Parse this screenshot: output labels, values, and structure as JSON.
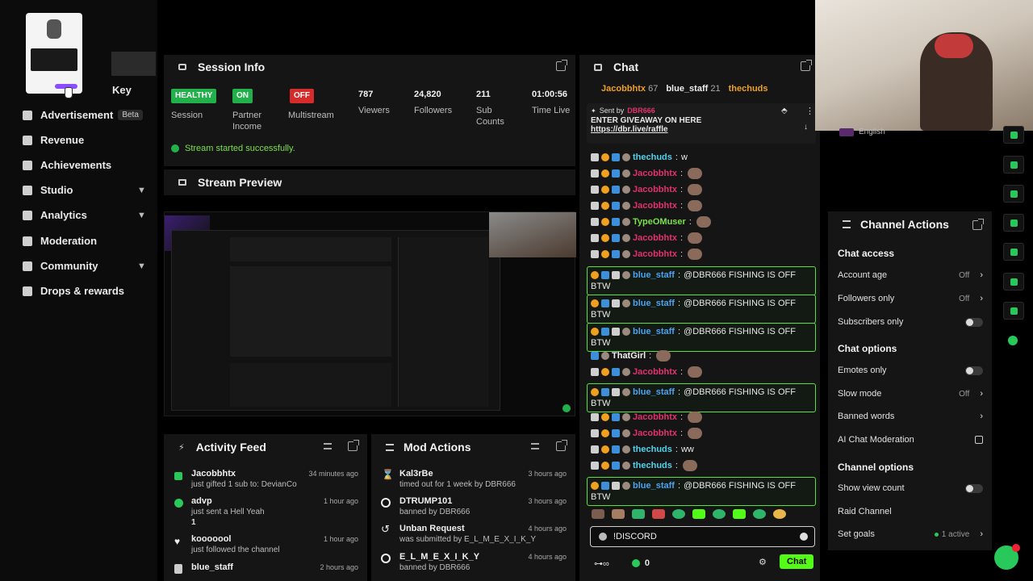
{
  "sidebar": {
    "partial_item": "Key",
    "items": [
      {
        "label": "Advertisement",
        "badge": "Beta",
        "icon": "ad-icon",
        "chevron": false
      },
      {
        "label": "Revenue",
        "icon": "revenue-icon",
        "chevron": false
      },
      {
        "label": "Achievements",
        "icon": "trophy-icon",
        "chevron": false
      },
      {
        "label": "Studio",
        "icon": "studio-icon",
        "chevron": true
      },
      {
        "label": "Analytics",
        "icon": "analytics-icon",
        "chevron": true
      },
      {
        "label": "Moderation",
        "icon": "wrench-icon",
        "chevron": false
      },
      {
        "label": "Community",
        "icon": "community-icon",
        "chevron": true
      },
      {
        "label": "Drops & rewards",
        "icon": "drops-icon",
        "chevron": false
      }
    ]
  },
  "session": {
    "title": "Session Info",
    "stats": [
      {
        "pill": "HEALTHY",
        "pill_color": "#22b04b",
        "label": "Session"
      },
      {
        "pill": "ON",
        "pill_color": "#22b04b",
        "label": "Partner Income"
      },
      {
        "pill": "OFF",
        "pill_color": "#d62b2b",
        "label": "Multistream"
      },
      {
        "value": "787",
        "label": "Viewers"
      },
      {
        "value": "24,820",
        "label": "Followers"
      },
      {
        "value": "211",
        "label": "Sub Counts"
      },
      {
        "value": "01:00:56",
        "label": "Time Live"
      }
    ],
    "status_message": "Stream started successfully."
  },
  "preview": {
    "title": "Stream Preview"
  },
  "chat": {
    "title": "Chat",
    "top_gifters": [
      {
        "name": "Jacobbhtx",
        "count": "67"
      },
      {
        "name": "blue_staff",
        "count": "21"
      },
      {
        "name": "thechuds",
        "count": ""
      }
    ],
    "pinned": {
      "sent_by_label": "Sent by",
      "sender": "DBR666",
      "text": "ENTER GIVEAWAY ON HERE",
      "link": "https://dbr.live/raffle"
    },
    "messages": [
      {
        "user": "thechuds",
        "color": "#4fd1e8",
        "text": "w",
        "hl": false
      },
      {
        "user": "Jacobbhtx",
        "color": "#e0336b",
        "text": "",
        "hl": false
      },
      {
        "user": "Jacobbhtx",
        "color": "#e0336b",
        "text": "",
        "hl": false
      },
      {
        "user": "Jacobbhtx",
        "color": "#e0336b",
        "text": "",
        "hl": false
      },
      {
        "user": "TypeOMuser",
        "color": "#7be04a",
        "text": "",
        "hl": false
      },
      {
        "user": "Jacobbhtx",
        "color": "#e0336b",
        "text": "",
        "hl": false
      },
      {
        "user": "Jacobbhtx",
        "color": "#e0336b",
        "text": "",
        "hl": false
      },
      {
        "user": "blue_staff",
        "color": "#4aa3f0",
        "text": "@DBR666 FISHING IS OFF BTW",
        "hl": true
      },
      {
        "user": "blue_staff",
        "color": "#4aa3f0",
        "text": "@DBR666 FISHING IS OFF BTW",
        "hl": true
      },
      {
        "user": "blue_staff",
        "color": "#4aa3f0",
        "text": "@DBR666 FISHING IS OFF BTW",
        "hl": true
      },
      {
        "user": "ThatGirl",
        "color": "#f2f2f2",
        "text": "",
        "hl": false
      },
      {
        "user": "Jacobbhtx",
        "color": "#e0336b",
        "text": "",
        "hl": false
      },
      {
        "user": "blue_staff",
        "color": "#4aa3f0",
        "text": "@DBR666 FISHING IS OFF BTW",
        "hl": true
      },
      {
        "user": "Jacobbhtx",
        "color": "#e0336b",
        "text": "",
        "hl": false
      },
      {
        "user": "Jacobbhtx",
        "color": "#e0336b",
        "text": "",
        "hl": false
      },
      {
        "user": "thechuds",
        "color": "#4fd1e8",
        "text": "ww",
        "hl": false
      },
      {
        "user": "thechuds",
        "color": "#4fd1e8",
        "text": "",
        "hl": false
      },
      {
        "user": "blue_staff",
        "color": "#4aa3f0",
        "text": "@DBR666 FISHING IS OFF BTW",
        "hl": true
      }
    ],
    "input_value": "!DISCORD",
    "points": "0",
    "send_label": "Chat"
  },
  "webcam": {
    "language": "English"
  },
  "channel_actions": {
    "title": "Channel Actions",
    "sections": [
      {
        "title": "Chat access",
        "rows": [
          {
            "label": "Account age",
            "state": "Off",
            "kind": "arrow"
          },
          {
            "label": "Followers only",
            "state": "Off",
            "kind": "arrow"
          },
          {
            "label": "Subscribers only",
            "state": "",
            "kind": "toggle"
          }
        ]
      },
      {
        "title": "Chat options",
        "rows": [
          {
            "label": "Emotes only",
            "state": "",
            "kind": "toggle"
          },
          {
            "label": "Slow mode",
            "state": "Off",
            "kind": "arrow"
          },
          {
            "label": "Banned words",
            "state": "",
            "kind": "arrow"
          },
          {
            "label": "AI Chat Moderation",
            "state": "",
            "kind": "external"
          }
        ]
      },
      {
        "title": "Channel options",
        "rows": [
          {
            "label": "Show view count",
            "state": "",
            "kind": "toggle"
          },
          {
            "label": "Raid Channel",
            "state": "",
            "kind": "none"
          },
          {
            "label": "Set goals",
            "state": "1 active",
            "kind": "arrow"
          }
        ]
      }
    ]
  },
  "activity": {
    "title": "Activity Feed",
    "items": [
      {
        "user": "Jacobbhtx",
        "line": "just gifted 1 sub to: DevianCo",
        "time": "34 minutes ago",
        "extra": ""
      },
      {
        "user": "advp",
        "line": "just sent a Hell Yeah",
        "time": "1 hour ago",
        "extra": "1"
      },
      {
        "user": "kooooool",
        "line": "just followed the channel",
        "time": "1 hour ago",
        "extra": ""
      },
      {
        "user": "blue_staff",
        "line": "",
        "time": "2 hours ago",
        "extra": ""
      }
    ]
  },
  "mod": {
    "title": "Mod Actions",
    "items": [
      {
        "user": "Kal3rBe",
        "line": "timed out for 1 week by DBR666",
        "time": "3 hours ago",
        "icon": "hourglass-icon"
      },
      {
        "user": "DTRUMP101",
        "line": "banned by DBR666",
        "time": "3 hours ago",
        "icon": "ban-icon"
      },
      {
        "user": "Unban Request",
        "line": "was submitted by E_L_M_E_X_I_K_Y",
        "time": "4 hours ago",
        "icon": "undo-icon"
      },
      {
        "user": "E_L_M_E_X_I_K_Y",
        "line": "banned by DBR666",
        "time": "4 hours ago",
        "icon": "ban-icon"
      }
    ]
  },
  "colors": {
    "accent": "#53fc18",
    "panel": "#151515",
    "bg": "#000000"
  }
}
